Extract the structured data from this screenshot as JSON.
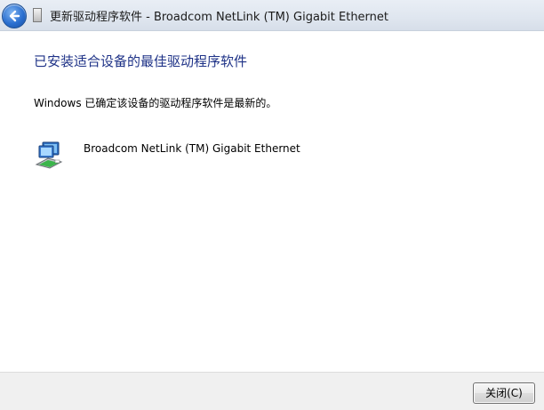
{
  "window": {
    "title": "更新驱动程序软件 - Broadcom NetLink (TM) Gigabit Ethernet",
    "back_icon": "back-arrow-icon",
    "device_icon": "device-icon"
  },
  "main": {
    "heading": "已安装适合设备的最佳驱动程序软件",
    "message": "Windows 已确定该设备的驱动程序软件是最新的。",
    "device": {
      "icon": "network-adapter-icon",
      "name": "Broadcom NetLink (TM) Gigabit Ethernet"
    }
  },
  "footer": {
    "close_label": "关闭(C)"
  },
  "colors": {
    "heading": "#1e3287",
    "titlebar": "#dfe6ef",
    "footer": "#f0f0f0"
  }
}
